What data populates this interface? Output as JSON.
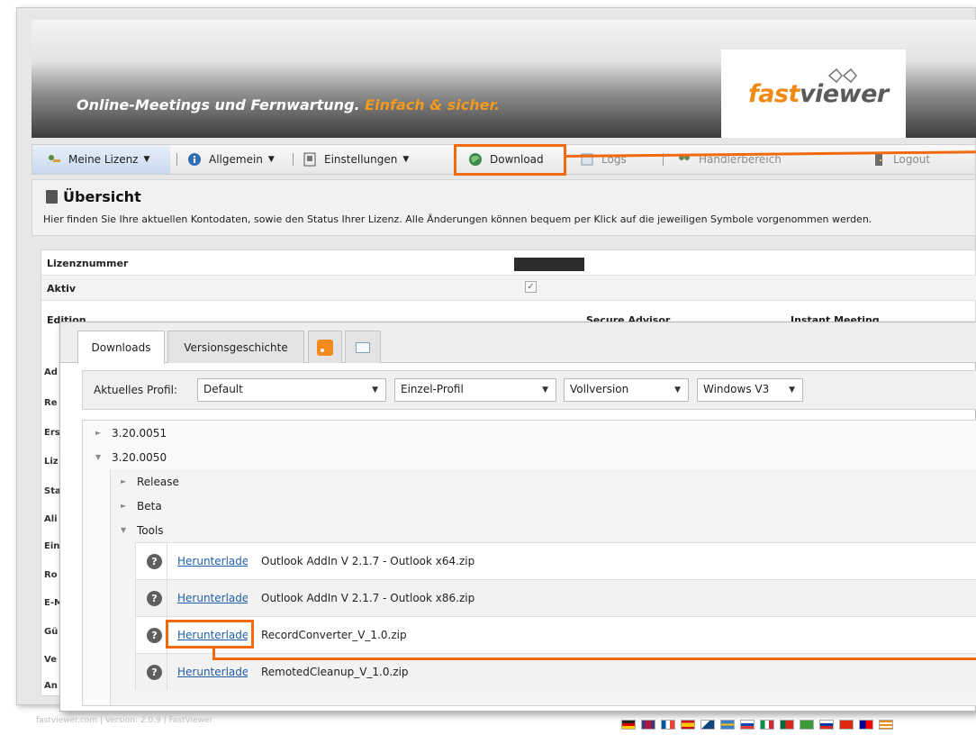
{
  "header": {
    "slogan": "Online-Meetings und Fernwartung.",
    "slogan_accent": "Einfach & sicher.",
    "logo_fast": "fast",
    "logo_viewer": "viewer"
  },
  "nav": {
    "items": [
      {
        "label": "Meine Lizenz",
        "icon": "key-users-icon",
        "dropdown": true
      },
      {
        "label": "Allgemein",
        "icon": "info-icon",
        "dropdown": true
      },
      {
        "label": "Einstellungen",
        "icon": "settings-icon",
        "dropdown": true
      },
      {
        "label": "Download",
        "icon": "globe-icon",
        "dropdown": false
      },
      {
        "label": "Logs",
        "icon": "logs-icon",
        "dropdown": false
      },
      {
        "label": "Händlerbereich",
        "icon": "dealer-icon",
        "dropdown": false
      },
      {
        "label": "Logout",
        "icon": "door-icon",
        "dropdown": false
      }
    ]
  },
  "overview": {
    "title": "Übersicht",
    "description": "Hier finden Sie Ihre aktuellen Kontodaten, sowie den Status Ihrer Lizenz. Alle Änderungen können bequem per Klick auf die jeweiligen Symbole vorgenommen werden."
  },
  "license": {
    "rows": [
      {
        "key": "Lizenznummer"
      },
      {
        "key": "Aktiv"
      },
      {
        "key": "Edition"
      }
    ],
    "columns": [
      "Secure Advisor",
      "Instant Meeting"
    ],
    "left_labels": [
      "Ad",
      "Re",
      "Ers",
      "Liz",
      "Sta",
      "Ali",
      "Ein",
      "Ro",
      "E-M",
      "Gü",
      "Ve",
      "An"
    ]
  },
  "downloads": {
    "tabs": [
      "Downloads",
      "Versionsgeschichte"
    ],
    "filter_label": "Aktuelles Profil:",
    "selects": [
      "Default",
      "Einzel-Profil",
      "Vollversion",
      "Windows V3"
    ],
    "versions": [
      "3.20.0051",
      "3.20.0050"
    ],
    "subfolders": [
      "Release",
      "Beta",
      "Tools"
    ],
    "link_label": "Herunterladen",
    "files": [
      "Outlook AddIn V 2.1.7 - Outlook x64.zip",
      "Outlook AddIn V 2.1.7 - Outlook x86.zip",
      "RecordConverter_V_1.0.zip",
      "RemotedCleanup_V_1.0.zip"
    ]
  },
  "footer": {
    "text": "fastviewer.com | Version: 2.0.9 | FastViewer"
  },
  "colors": {
    "accent_orange": "#f26a10",
    "link_blue": "#1f5fa8",
    "logo_orange": "#f08a12"
  }
}
